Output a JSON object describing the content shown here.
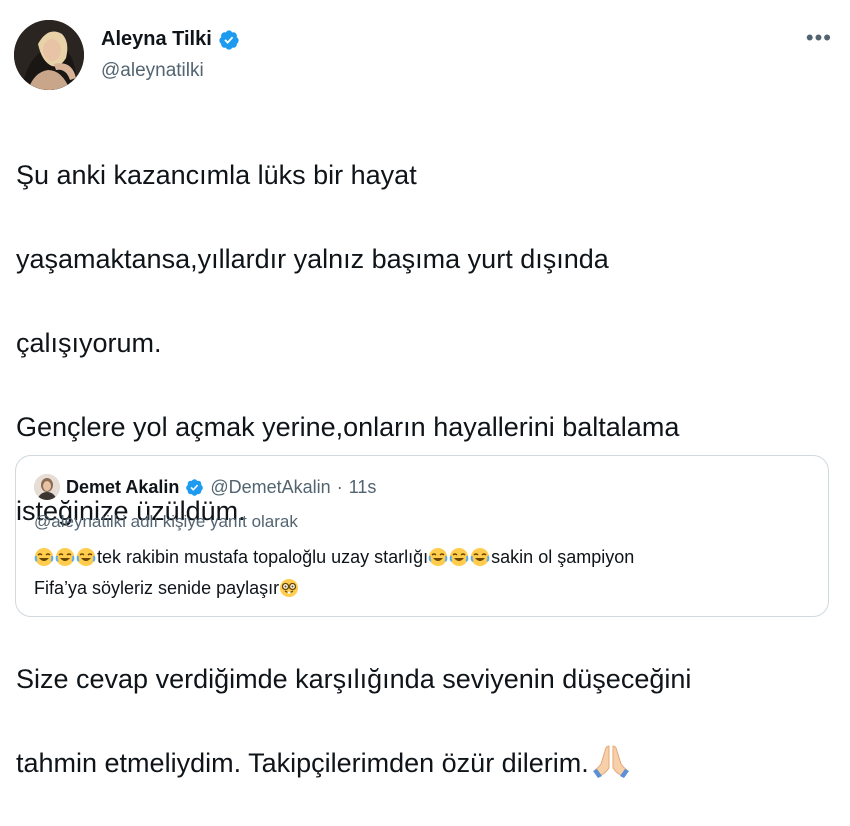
{
  "author": {
    "name": "Aleyna Tilki",
    "handle": "@aleynatilki",
    "avatar": "profile-photo"
  },
  "menu": {
    "label": "•••"
  },
  "tweet": {
    "lines_a": [
      "Şu anki kazancımla lüks bir hayat",
      "yaşamaktansa,yıllardır yalnız başıma yurt dışında",
      "çalışıyorum.",
      "Gençlere yol açmak yerine,onların hayallerini baltalama",
      "isteğinize üzüldüm."
    ],
    "lines_b": [
      "Size cevap verdiğimde karşılığında seviyenin düşeceğini",
      "tahmin etmeliydim. Takipçilerimden özür dilerim."
    ],
    "trailing_emoji": "folded-hands-emoji"
  },
  "quoted": {
    "name": "Demet Akalin",
    "handle": "@DemetAkalin",
    "separator": "·",
    "time": "11s",
    "reply_context": "@aleynatilki adlı kişiye yanıt olarak",
    "line1_text": "tek rakibin mustafa topaloğlu uzay starlığı",
    "line1_tail": "sakin ol şampiyon",
    "line2_text": "Fifa’ya söyleriz senide paylaşır",
    "emojis": {
      "laughing": "face-with-tears-of-joy-emoji",
      "nerd": "nerd-face-emoji"
    }
  },
  "colors": {
    "verified": "#1d9bf0",
    "text": "#0f1419",
    "secondary": "#536471",
    "border": "#cfd9de"
  }
}
